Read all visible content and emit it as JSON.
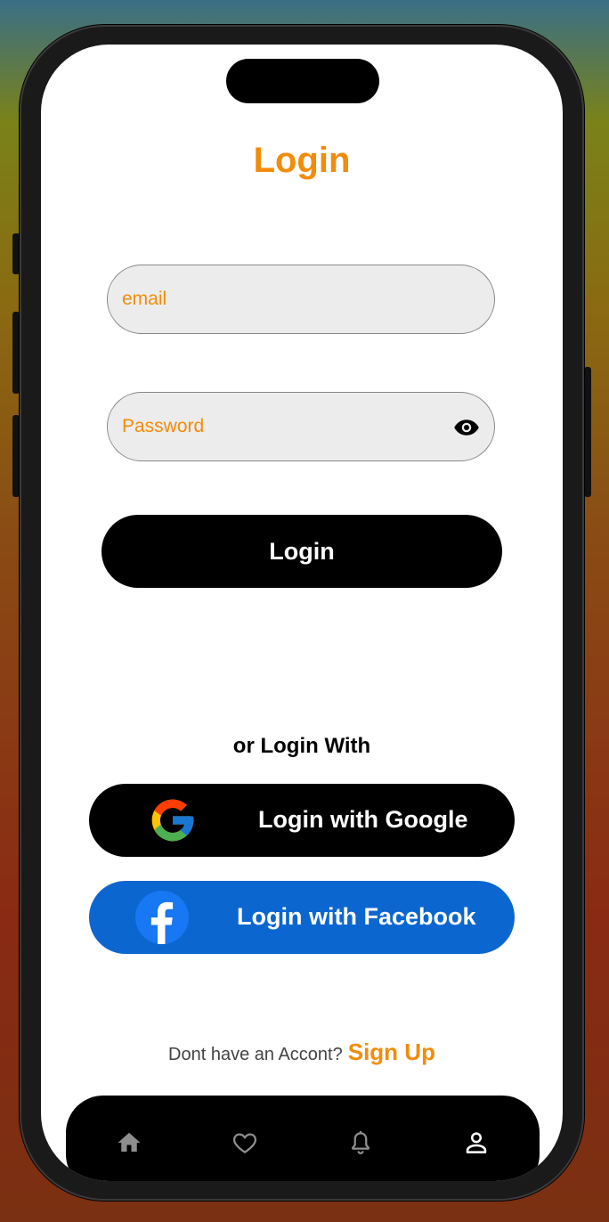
{
  "header": {
    "title": "Login"
  },
  "form": {
    "email_placeholder": "email",
    "password_placeholder": "Password",
    "login_label": "Login"
  },
  "social": {
    "divider_text": "or Login With",
    "google_label": "Login with Google",
    "facebook_label": "Login with Facebook"
  },
  "footer": {
    "prompt": "Dont have an Accont?",
    "signup_label": "Sign Up"
  },
  "nav": {
    "items": [
      "home-icon",
      "heart-icon",
      "bell-icon",
      "profile-icon"
    ],
    "active": "profile-icon"
  },
  "colors": {
    "accent": "#f28c0a",
    "facebook": "#0b66d0",
    "field_bg": "#ececec",
    "dark": "#000000"
  }
}
